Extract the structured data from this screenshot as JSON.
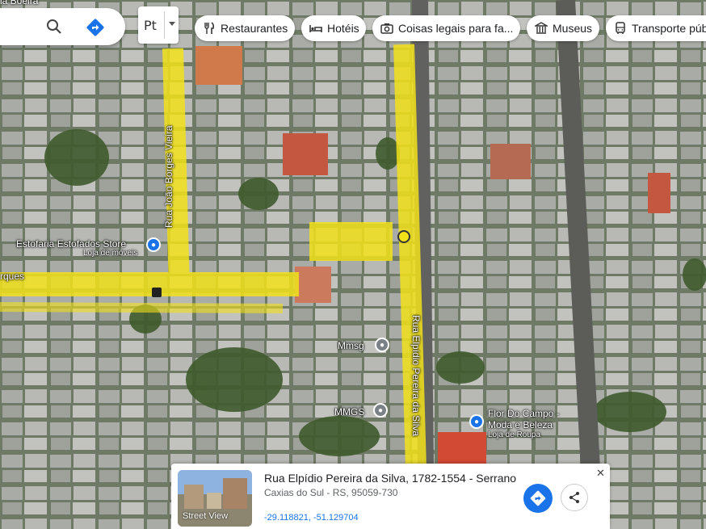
{
  "search": {
    "title": "ia Boeira",
    "search_icon": "search-icon",
    "directions_icon": "directions-icon"
  },
  "language_button": {
    "label": "Pt"
  },
  "chips": [
    {
      "label": "Restaurantes",
      "icon": "fork-knife-icon"
    },
    {
      "label": "Hotéis",
      "icon": "bed-icon"
    },
    {
      "label": "Coisas legais para fa...",
      "icon": "camera-icon"
    },
    {
      "label": "Museus",
      "icon": "museum-icon"
    },
    {
      "label": "Transporte públ",
      "icon": "bus-icon"
    }
  ],
  "map": {
    "roads": {
      "rua_joao": "Rua João Borges Vieira",
      "rua_elpidio": "Rua Elpídio Pereira da Silva",
      "rua_left": "rques"
    },
    "places": [
      {
        "name": "Estofaria Estofados Store",
        "category": "Loja de móveis"
      },
      {
        "name": "Mmsg",
        "category": ""
      },
      {
        "name": "MMGS",
        "category": ""
      },
      {
        "name": "Flor Do Campo -",
        "name2": "Moda e Beleza",
        "category": "Loja de Roupa"
      }
    ],
    "highlight_color": "#f2e21a"
  },
  "card": {
    "thumbnail_label": "Street View",
    "title": "Rua Elpídio Pereira da Silva, 1782-1554 - Serrano",
    "subtitle": "Caxias do Sul - RS, 95059-730",
    "coordinates": "-29.118821, -51.129704",
    "directions_icon": "directions-icon",
    "share_icon": "share-icon",
    "close_label": "✕"
  }
}
